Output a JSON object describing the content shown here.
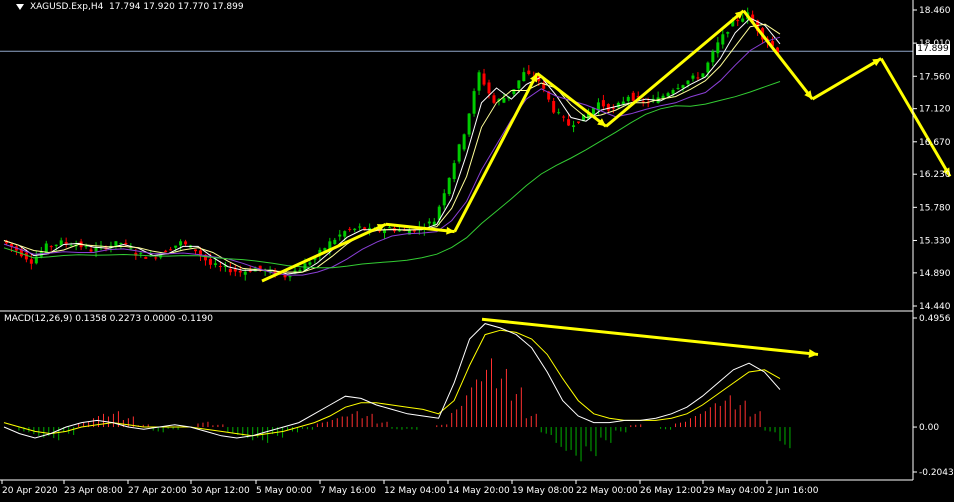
{
  "header": {
    "symbol": "XAGUSD.Exp,H4",
    "ohlc": "17.794 17.920 17.770 17.899"
  },
  "macd_label": "MACD(12,26,9) 0.1358 0.2273 0.0000 -0.1190",
  "current_price": "17.899",
  "colors": {
    "background": "#000000",
    "axis": "#ffffff",
    "bull": "#00cc00",
    "bear": "#ff0000",
    "ma_fast": "#ffffff",
    "ma_mid": "#ffff99",
    "ma_slow": "#8a3fd6",
    "ma_long": "#33cc33",
    "arrows": "#ffff00",
    "macd_up": "#ff3030",
    "macd_down": "#00b000",
    "signal": "#ffff00",
    "macd_line": "#ffffff"
  },
  "chart_data": [
    {
      "type": "line",
      "title": "",
      "price_axis_ticks": [
        "18.460",
        "18.010",
        "17.560",
        "17.120",
        "16.670",
        "16.230",
        "15.780",
        "15.330",
        "14.890",
        "14.440"
      ],
      "ylim": [
        14.44,
        18.46
      ],
      "time_axis_ticks": [
        "20 Apr 2020",
        "23 Apr 08:00",
        "27 Apr 20:00",
        "30 Apr 12:00",
        "5 May 00:00",
        "7 May 16:00",
        "12 May 04:00",
        "14 May 20:00",
        "19 May 08:00",
        "22 May 00:00",
        "26 May 12:00",
        "29 May 04:00",
        "2 Jun 16:00"
      ],
      "close_path": [
        15.33,
        15.2,
        15.05,
        15.25,
        15.3,
        15.28,
        15.2,
        15.25,
        15.3,
        15.15,
        15.1,
        15.2,
        15.3,
        15.2,
        15.0,
        14.95,
        14.9,
        14.95,
        14.9,
        14.85,
        14.95,
        15.1,
        15.3,
        15.45,
        15.5,
        15.45,
        15.5,
        15.45,
        15.5,
        15.6,
        16.2,
        16.8,
        17.6,
        17.2,
        17.3,
        17.6,
        17.5,
        17.1,
        16.9,
        17.0,
        17.2,
        17.1,
        17.3,
        17.2,
        17.25,
        17.4,
        17.5,
        17.6,
        18.0,
        18.3,
        18.4,
        18.1,
        17.9
      ],
      "projection_points": [
        {
          "t": 0.0,
          "price": 14.78
        },
        {
          "t": 0.18,
          "price": 15.55
        },
        {
          "t": 0.28,
          "price": 15.45
        },
        {
          "t": 0.4,
          "price": 17.6
        },
        {
          "t": 0.5,
          "price": 16.88
        },
        {
          "t": 0.7,
          "price": 18.45
        },
        {
          "t": 0.8,
          "price": 17.25
        },
        {
          "t": 0.9,
          "price": 17.8
        },
        {
          "t": 1.0,
          "price": 16.2
        }
      ]
    },
    {
      "type": "bar",
      "title": "MACD(12,26,9)",
      "macd_axis_ticks": [
        "0.4956",
        "0.00",
        "-0.2043"
      ],
      "ylim": [
        -0.2043,
        0.4956
      ],
      "histogram": [
        0.0,
        -0.02,
        -0.04,
        -0.05,
        -0.03,
        0.02,
        0.05,
        0.06,
        0.04,
        0.01,
        -0.02,
        -0.01,
        0.0,
        0.02,
        0.01,
        -0.03,
        -0.05,
        -0.06,
        -0.04,
        -0.02,
        -0.01,
        0.02,
        0.04,
        0.06,
        0.05,
        0.02,
        -0.01,
        -0.01,
        0.0,
        0.01,
        0.08,
        0.18,
        0.26,
        0.22,
        0.15,
        0.05,
        -0.03,
        -0.09,
        -0.13,
        -0.11,
        -0.06,
        -0.02,
        0.01,
        0.0,
        -0.01,
        0.02,
        0.05,
        0.09,
        0.12,
        0.1,
        0.06,
        -0.02,
        -0.08
      ],
      "macd_line": [
        0.0,
        -0.03,
        -0.05,
        -0.03,
        0.0,
        0.02,
        0.03,
        0.02,
        0.0,
        -0.01,
        0.0,
        0.01,
        0.0,
        -0.02,
        -0.04,
        -0.05,
        -0.04,
        -0.02,
        0.0,
        0.02,
        0.06,
        0.1,
        0.14,
        0.13,
        0.1,
        0.08,
        0.06,
        0.05,
        0.04,
        0.2,
        0.4,
        0.47,
        0.45,
        0.42,
        0.36,
        0.25,
        0.12,
        0.05,
        0.02,
        0.02,
        0.03,
        0.03,
        0.04,
        0.06,
        0.09,
        0.14,
        0.2,
        0.26,
        0.29,
        0.25,
        0.17
      ],
      "signal_line": [
        0.02,
        0.0,
        -0.02,
        -0.03,
        -0.02,
        0.0,
        0.01,
        0.02,
        0.01,
        0.0,
        0.0,
        0.0,
        0.0,
        -0.01,
        -0.02,
        -0.03,
        -0.04,
        -0.03,
        -0.02,
        0.0,
        0.02,
        0.05,
        0.09,
        0.11,
        0.11,
        0.1,
        0.09,
        0.08,
        0.06,
        0.12,
        0.28,
        0.42,
        0.44,
        0.43,
        0.4,
        0.33,
        0.22,
        0.12,
        0.06,
        0.04,
        0.03,
        0.03,
        0.03,
        0.04,
        0.06,
        0.1,
        0.15,
        0.2,
        0.25,
        0.26,
        0.22
      ],
      "trend_arrow": [
        {
          "t": 0.0,
          "value": 0.49
        },
        {
          "t": 1.0,
          "value": 0.33
        }
      ]
    }
  ]
}
